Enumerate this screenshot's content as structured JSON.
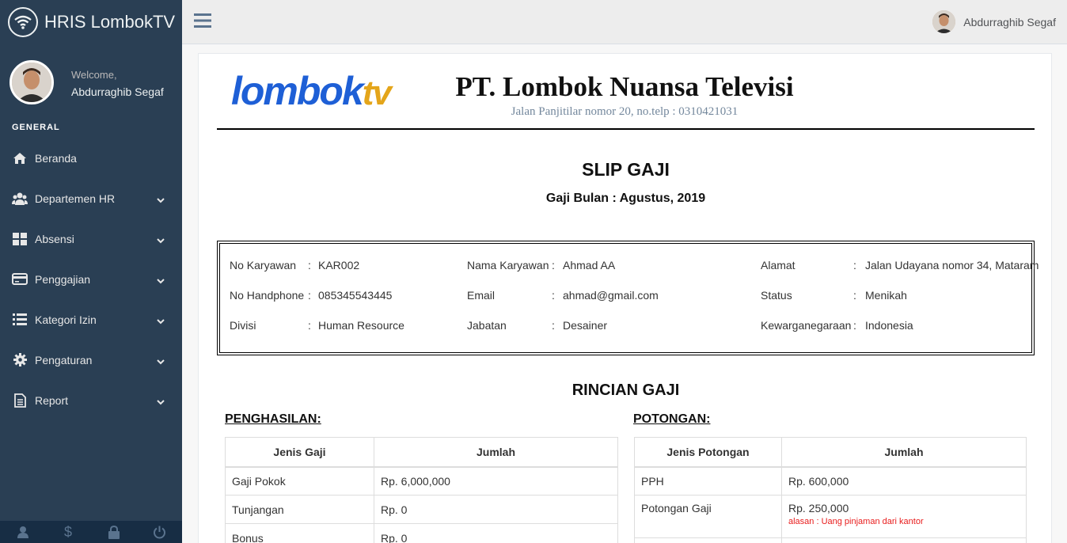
{
  "app": {
    "title": "HRIS LombokTV"
  },
  "profile": {
    "welcome": "Welcome,",
    "name": "Abdurraghib Segaf"
  },
  "sidebar": {
    "section": "GENERAL",
    "items": [
      {
        "label": "Beranda",
        "icon": "home-icon"
      },
      {
        "label": "Departemen HR",
        "icon": "users-icon"
      },
      {
        "label": "Absensi",
        "icon": "grid-icon"
      },
      {
        "label": "Penggajian",
        "icon": "credit-card-icon"
      },
      {
        "label": "Kategori Izin",
        "icon": "list-icon"
      },
      {
        "label": "Pengaturan",
        "icon": "gear-icon"
      },
      {
        "label": "Report",
        "icon": "document-icon"
      }
    ]
  },
  "topnav": {
    "user_name": "Abdurraghib Segaf"
  },
  "letterhead": {
    "logo_part1": "lombok",
    "logo_part2": "tv",
    "company": "PT. Lombok Nuansa Televisi",
    "address": "Jalan Panjitilar nomor 20, no.telp : 0310421031"
  },
  "slip": {
    "title": "SLIP GAJI",
    "period": "Gaji Bulan : Agustus, 2019"
  },
  "employee": {
    "rows": [
      [
        {
          "label": "No Karyawan",
          "value": "KAR002"
        },
        {
          "label": "Nama Karyawan",
          "value": "Ahmad AA"
        },
        {
          "label": "Alamat",
          "value": "Jalan Udayana nomor 34, Mataram"
        }
      ],
      [
        {
          "label": "No Handphone",
          "value": "085345543445"
        },
        {
          "label": "Email",
          "value": "ahmad@gmail.com"
        },
        {
          "label": "Status",
          "value": "Menikah"
        }
      ],
      [
        {
          "label": "Divisi",
          "value": "Human Resource"
        },
        {
          "label": "Jabatan",
          "value": "Desainer"
        },
        {
          "label": "Kewarganegaraan",
          "value": "Indonesia"
        }
      ]
    ],
    "separator": ":"
  },
  "rincian": {
    "title": "RINCIAN GAJI",
    "penghasilan": {
      "title": "PENGHASILAN:",
      "headers": [
        "Jenis Gaji",
        "Jumlah"
      ],
      "rows": [
        [
          "Gaji Pokok",
          "Rp. 6,000,000"
        ],
        [
          "Tunjangan",
          "Rp. 0"
        ],
        [
          "Bonus",
          "Rp. 0"
        ]
      ]
    },
    "potongan": {
      "title": "POTONGAN:",
      "headers": [
        "Jenis Potongan",
        "Jumlah"
      ],
      "rows": [
        [
          "PPH",
          "Rp. 600,000"
        ],
        [
          "Potongan Gaji",
          "Rp. 250,000"
        ],
        [
          "",
          ""
        ]
      ],
      "reason": "alasan : Uang pinjaman dari kantor"
    }
  }
}
